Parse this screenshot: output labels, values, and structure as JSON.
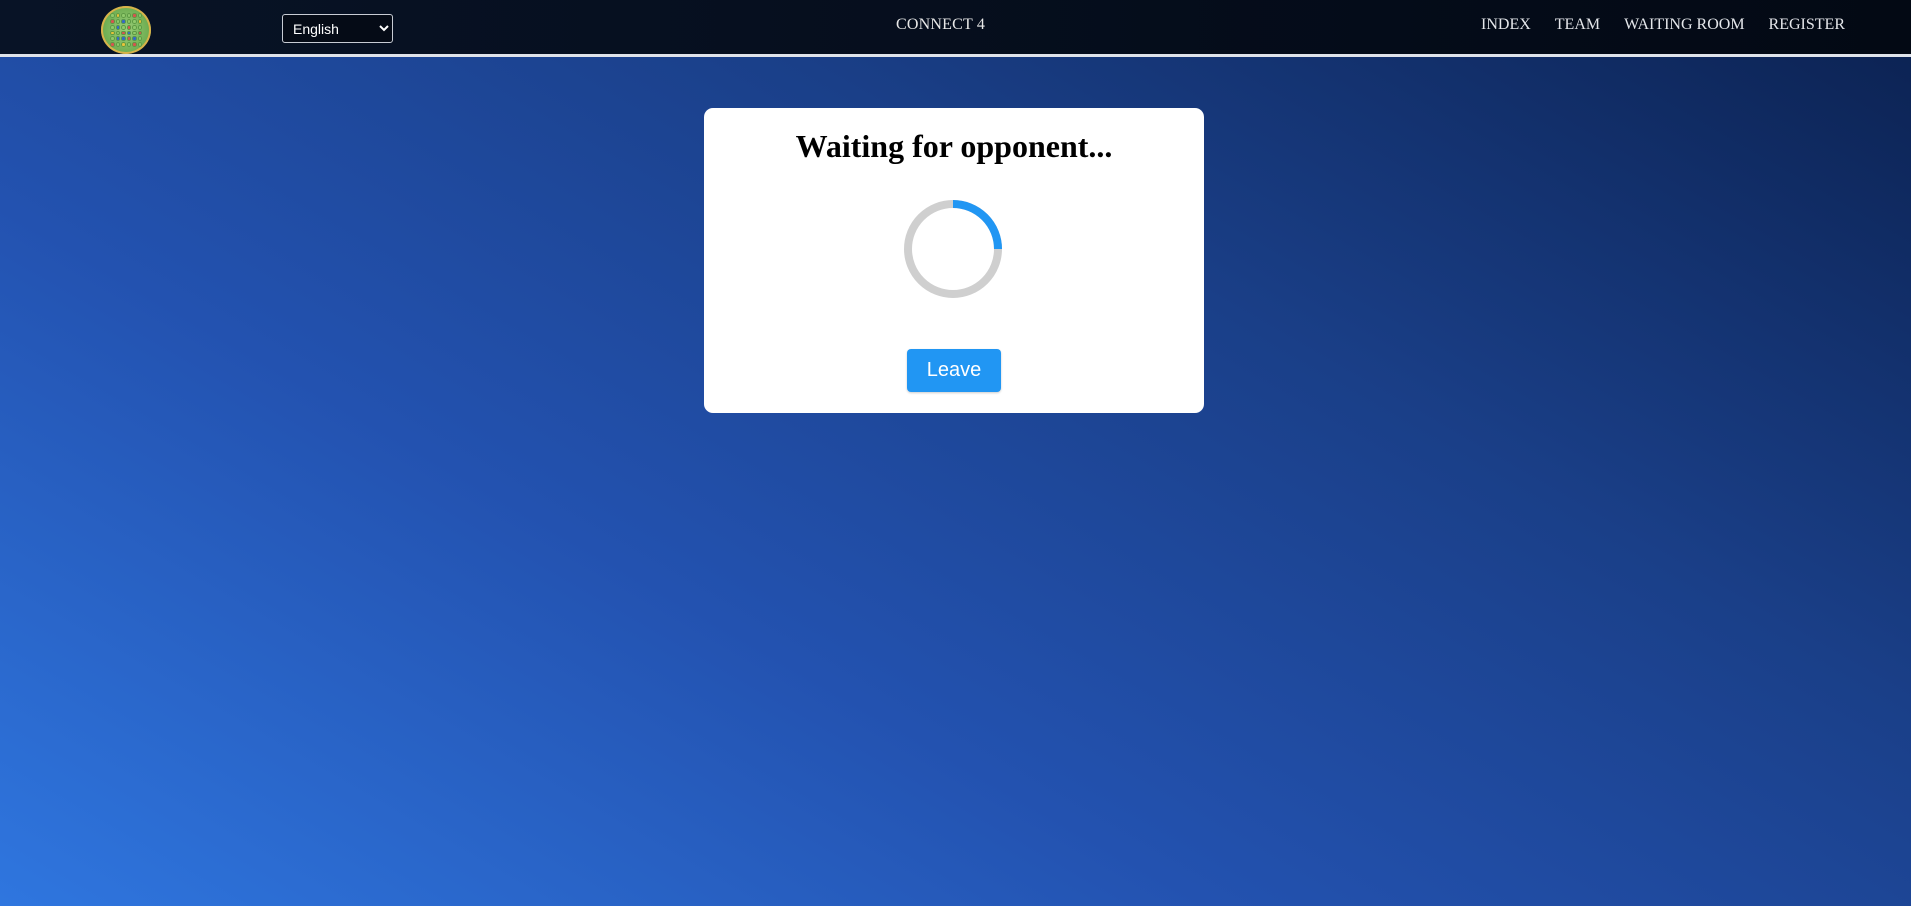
{
  "header": {
    "language_options": [
      "English"
    ],
    "language_selected": "English",
    "brand": "CONNECT 4",
    "nav": [
      "INDEX",
      "TEAM",
      "WAITING ROOM",
      "REGISTER"
    ]
  },
  "waiting_card": {
    "title": "Waiting for opponent...",
    "leave_label": "Leave"
  },
  "colors": {
    "accent": "#2196f3",
    "spinner_track": "#cfcfcf",
    "nav_background": "#050c18"
  },
  "icons": {
    "logo": "connect-four-logo-icon",
    "spinner": "loading-spinner-icon"
  }
}
